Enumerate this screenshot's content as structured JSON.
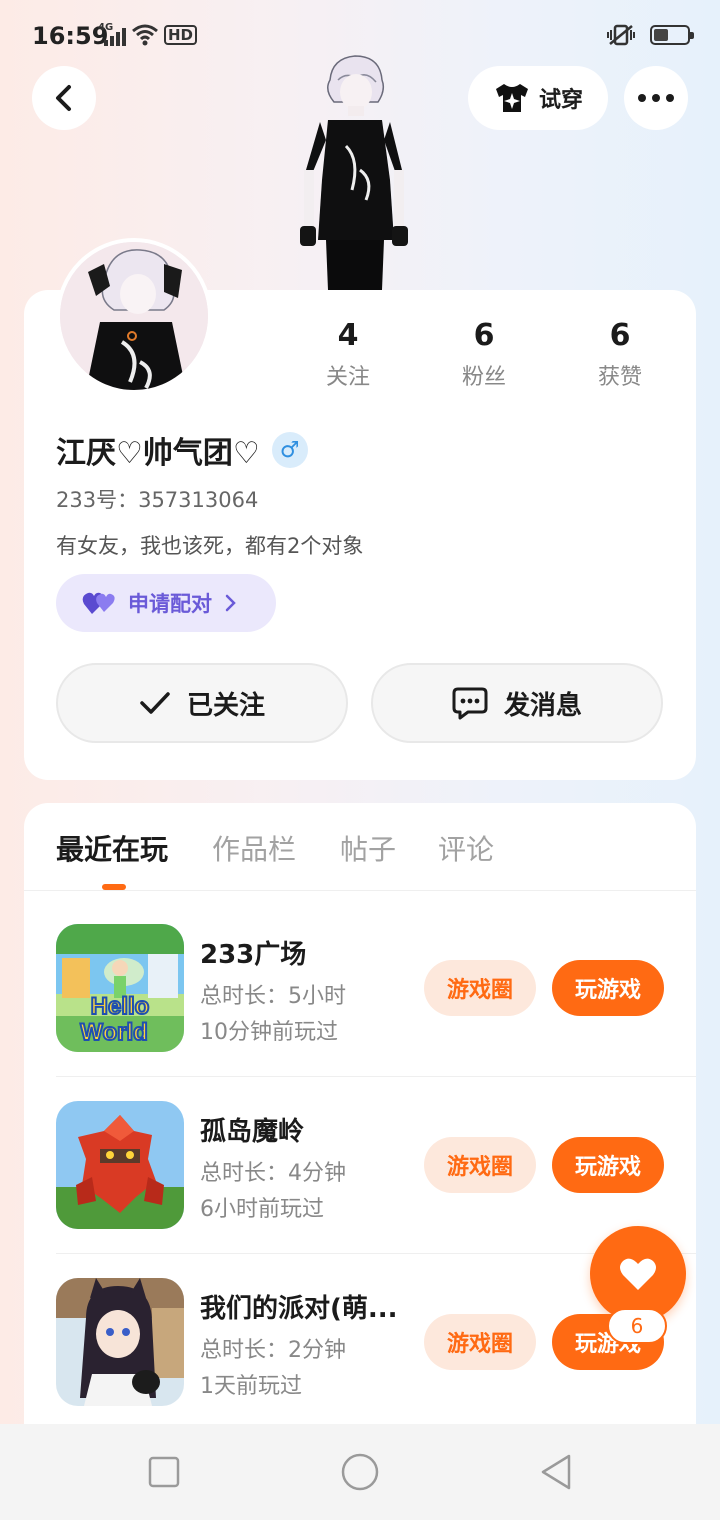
{
  "status_bar": {
    "time": "16:59",
    "network": "4G",
    "hd_label": "HD",
    "battery_level": 0.45
  },
  "header": {
    "try_on_label": "试穿"
  },
  "profile": {
    "stats": [
      {
        "value": "4",
        "label": "关注"
      },
      {
        "value": "6",
        "label": "粉丝"
      },
      {
        "value": "6",
        "label": "获赞"
      }
    ],
    "username": "江厌♡帅气团♡",
    "gender_icon": "♂",
    "uid": "233号：357313064",
    "bio": "有女友，我也该死，都有2个对象",
    "pair_label": "申请配对",
    "follow_label": "已关注",
    "message_label": "发消息"
  },
  "tabs": [
    {
      "label": "最近在玩",
      "active": true
    },
    {
      "label": "作品栏",
      "active": false
    },
    {
      "label": "帖子",
      "active": false
    },
    {
      "label": "评论",
      "active": false
    }
  ],
  "games": [
    {
      "name": "233广场",
      "duration": "总时长：5小时",
      "last_played": "10分钟前玩过",
      "circle_label": "游戏圈",
      "play_label": "玩游戏",
      "thumb_text_1": "Hello",
      "thumb_text_2": "World"
    },
    {
      "name": "孤岛魔岭",
      "duration": "总时长：4分钟",
      "last_played": "6小时前玩过",
      "circle_label": "游戏圈",
      "play_label": "玩游戏"
    },
    {
      "name": "我们的派对(萌...",
      "duration": "总时长：2分钟",
      "last_played": "1天前玩过",
      "circle_label": "游戏圈",
      "play_label": "玩游戏"
    }
  ],
  "like_fab": {
    "count": "6"
  },
  "colors": {
    "accent": "#ff6a13",
    "pair": "#6a5ad8"
  }
}
